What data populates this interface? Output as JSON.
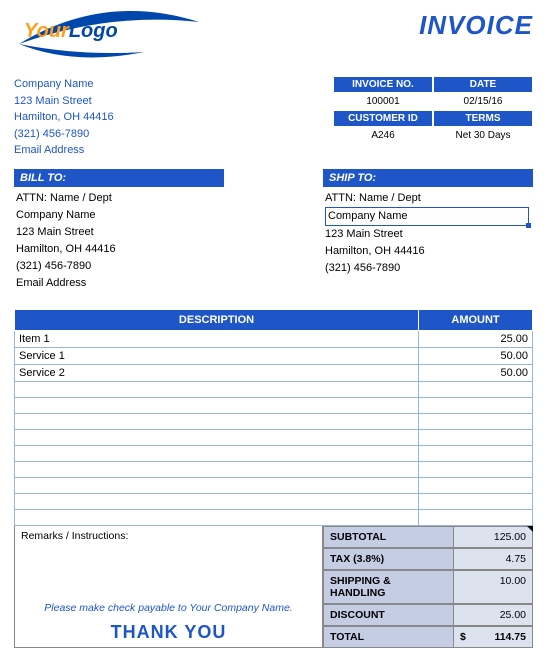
{
  "logo": {
    "your": "Your",
    "logo": "Logo"
  },
  "title": "INVOICE",
  "company": {
    "name": "Company Name",
    "street": "123 Main Street",
    "citystate": "Hamilton, OH  44416",
    "phone": "(321) 456-7890",
    "email": "Email Address"
  },
  "meta": {
    "inv_no_label": "INVOICE NO.",
    "inv_no": "100001",
    "date_label": "DATE",
    "date": "02/15/16",
    "cust_id_label": "CUSTOMER ID",
    "cust_id": "A246",
    "terms_label": "TERMS",
    "terms": "Net 30 Days"
  },
  "billto": {
    "header": "BILL TO:",
    "attn": "ATTN: Name / Dept",
    "company": "Company Name",
    "street": "123 Main Street",
    "citystate": "Hamilton, OH  44416",
    "phone": "(321) 456-7890",
    "email": "Email Address"
  },
  "shipto": {
    "header": "SHIP TO:",
    "attn": "ATTN: Name / Dept",
    "company": "Company Name",
    "street": "123 Main Street",
    "citystate": "Hamilton, OH  44416",
    "phone": "(321) 456-7890"
  },
  "cols": {
    "desc": "DESCRIPTION",
    "amt": "AMOUNT"
  },
  "lines": [
    {
      "desc": "Item 1",
      "amt": "25.00"
    },
    {
      "desc": "Service 1",
      "amt": "50.00"
    },
    {
      "desc": "Service 2",
      "amt": "50.00"
    },
    {
      "desc": "",
      "amt": ""
    },
    {
      "desc": "",
      "amt": ""
    },
    {
      "desc": "",
      "amt": ""
    },
    {
      "desc": "",
      "amt": ""
    },
    {
      "desc": "",
      "amt": ""
    },
    {
      "desc": "",
      "amt": ""
    },
    {
      "desc": "",
      "amt": ""
    },
    {
      "desc": "",
      "amt": ""
    },
    {
      "desc": "",
      "amt": ""
    }
  ],
  "remarks": {
    "label": "Remarks / Instructions:",
    "payable": "Please make check payable to Your Company Name.",
    "thanks": "THANK YOU"
  },
  "totals": {
    "subtotal_label": "SUBTOTAL",
    "subtotal": "125.00",
    "tax_label": "TAX (3.8%)",
    "tax": "4.75",
    "ship_label": "SHIPPING & HANDLING",
    "ship": "10.00",
    "discount_label": "DISCOUNT",
    "discount": "25.00",
    "total_label": "TOTAL",
    "total_currency": "$",
    "total": "114.75"
  }
}
